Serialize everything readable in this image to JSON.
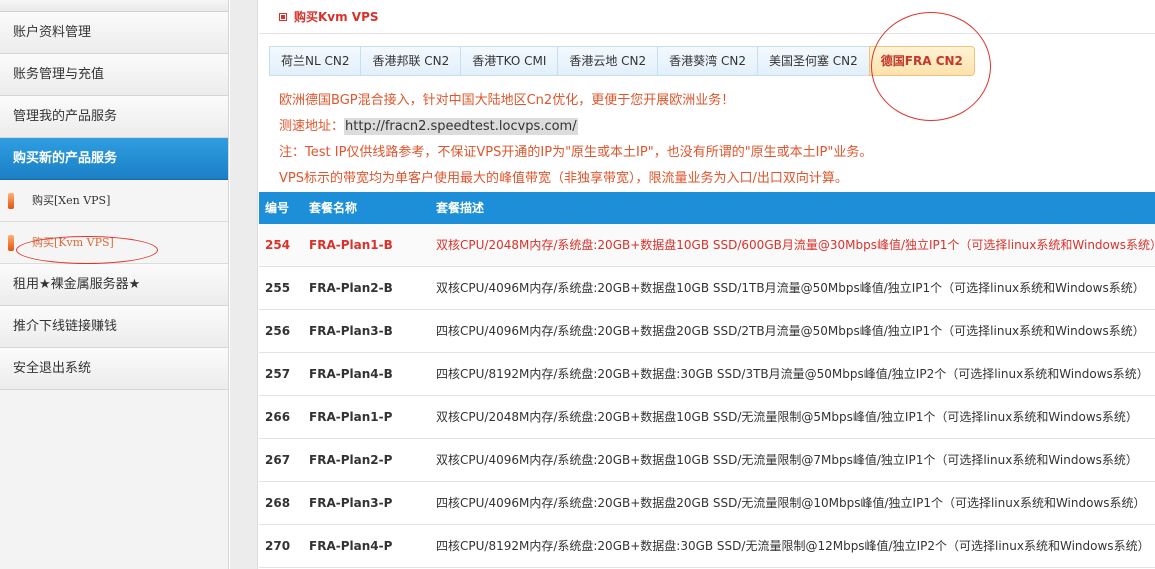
{
  "sidebar": {
    "items": [
      {
        "label": "账户资料管理"
      },
      {
        "label": "账务管理与充值"
      },
      {
        "label": "管理我的产品服务"
      },
      {
        "label": "购买新的产品服务"
      }
    ],
    "sub_items": [
      {
        "label": "购买[Xen VPS]"
      },
      {
        "label": "购买[Kvm VPS]"
      }
    ],
    "items_after": [
      {
        "label": "租用★裸金属服务器★"
      },
      {
        "label": "推介下线链接赚钱"
      },
      {
        "label": "安全退出系统"
      }
    ]
  },
  "page": {
    "title": "购买Kvm VPS"
  },
  "tabs": [
    {
      "label": "荷兰NL CN2"
    },
    {
      "label": "香港邦联 CN2"
    },
    {
      "label": "香港TKO CMI"
    },
    {
      "label": "香港云地 CN2"
    },
    {
      "label": "香港葵湾 CN2"
    },
    {
      "label": "美国圣何塞 CN2"
    },
    {
      "label": "德国FRA CN2"
    }
  ],
  "notes": {
    "line1": "欧洲德国BGP混合接入，针对中国大陆地区Cn2优化，更便于您开展欧洲业务！",
    "line2_prefix": "测速地址：",
    "line2_url": "http://fracn2.speedtest.locvps.com/",
    "line3": "注：Test IP仅供线路参考，不保证VPS开通的IP为\"原生或本土IP\"，也没有所谓的\"原生或本土IP\"业务。",
    "line4": "VPS标示的带宽均为单客户使用最大的峰值带宽（非独享带宽），限流量业务为入口/出口双向计算。"
  },
  "table": {
    "headers": {
      "id": "编号",
      "name": "套餐名称",
      "desc": "套餐描述"
    },
    "rows": [
      {
        "id": "254",
        "name": "FRA-Plan1-B",
        "desc": "双核CPU/2048M内存/系统盘:20GB+数据盘10GB SSD/600GB月流量@30Mbps峰值/独立IP1个（可选择linux系统和Windows系统）"
      },
      {
        "id": "255",
        "name": "FRA-Plan2-B",
        "desc": "双核CPU/4096M内存/系统盘:20GB+数据盘10GB SSD/1TB月流量@50Mbps峰值/独立IP1个（可选择linux系统和Windows系统）"
      },
      {
        "id": "256",
        "name": "FRA-Plan3-B",
        "desc": "四核CPU/4096M内存/系统盘:20GB+数据盘20GB SSD/2TB月流量@50Mbps峰值/独立IP1个（可选择linux系统和Windows系统）"
      },
      {
        "id": "257",
        "name": "FRA-Plan4-B",
        "desc": "四核CPU/8192M内存/系统盘:20GB+数据盘:30GB SSD/3TB月流量@50Mbps峰值/独立IP2个（可选择linux系统和Windows系统）"
      },
      {
        "id": "266",
        "name": "FRA-Plan1-P",
        "desc": "双核CPU/2048M内存/系统盘:20GB+数据盘10GB SSD/无流量限制@5Mbps峰值/独立IP1个（可选择linux系统和Windows系统）"
      },
      {
        "id": "267",
        "name": "FRA-Plan2-P",
        "desc": "双核CPU/4096M内存/系统盘:20GB+数据盘10GB SSD/无流量限制@7Mbps峰值/独立IP1个（可选择linux系统和Windows系统）"
      },
      {
        "id": "268",
        "name": "FRA-Plan3-P",
        "desc": "四核CPU/4096M内存/系统盘:20GB+数据盘20GB SSD/无流量限制@10Mbps峰值/独立IP1个（可选择linux系统和Windows系统）"
      },
      {
        "id": "270",
        "name": "FRA-Plan4-P",
        "desc": "四核CPU/8192M内存/系统盘:20GB+数据盘:30GB SSD/无流量限制@12Mbps峰值/独立IP2个（可选择linux系统和Windows系统）"
      }
    ]
  },
  "colors": {
    "accent_blue": "#1d8fd8",
    "note_red": "#e0552c",
    "annotation_red": "#e0332a"
  }
}
